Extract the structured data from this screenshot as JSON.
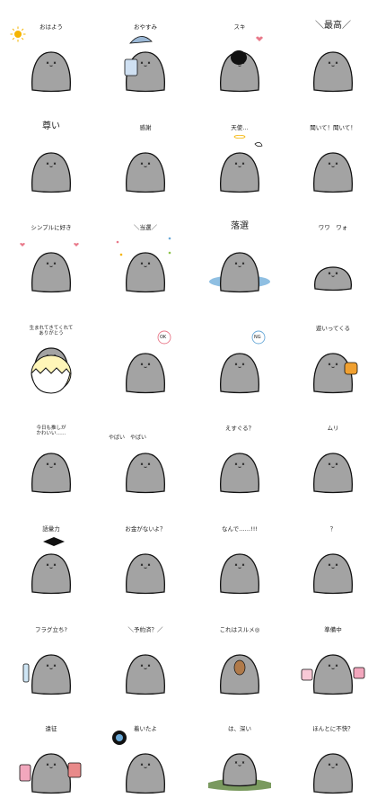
{
  "sheet_title": "",
  "stickers": [
    {
      "caption": "おはよう",
      "icon": "sun-icon"
    },
    {
      "caption": "おやすみ",
      "icon": "nightcap-icon"
    },
    {
      "caption": "スキ",
      "icon": "heart-icon"
    },
    {
      "caption": "＼最高／",
      "icon": ""
    },
    {
      "caption": "尊い",
      "icon": ""
    },
    {
      "caption": "感謝",
      "icon": ""
    },
    {
      "caption": "天使…",
      "icon": "wings-icon"
    },
    {
      "caption": "聞いて！聞いて！",
      "icon": ""
    },
    {
      "caption": "シンプルに好き",
      "icon": "hearts-icon"
    },
    {
      "caption": "＼当選／",
      "icon": "sparkle-icon"
    },
    {
      "caption": "落選",
      "icon": "puddle-icon"
    },
    {
      "caption": "ワワ　ワォ",
      "icon": ""
    },
    {
      "caption": "生まれてきてくれて\nありがとう",
      "icon": "egg-icon"
    },
    {
      "caption": "",
      "icon": "ok-bubble-icon",
      "bubble": "OK"
    },
    {
      "caption": "",
      "icon": "ng-bubble-icon",
      "bubble": "NG"
    },
    {
      "caption": "遊いってくる",
      "icon": "bag-icon"
    },
    {
      "caption": "今日も推しが\nかわいい……",
      "icon": ""
    },
    {
      "caption": "",
      "icon": "yabai-text-icon",
      "side": "やばい　やばい"
    },
    {
      "caption": "えすぐる？",
      "icon": ""
    },
    {
      "caption": "ムリ",
      "icon": ""
    },
    {
      "caption": "語彙力",
      "icon": "graduation-cap-icon"
    },
    {
      "caption": "お金がないよ？",
      "icon": ""
    },
    {
      "caption": "なんで……!!!",
      "icon": ""
    },
    {
      "caption": "？",
      "icon": ""
    },
    {
      "caption": "フラグ立ち?",
      "icon": "glowstick-icon"
    },
    {
      "caption": "＼予約済？／",
      "icon": ""
    },
    {
      "caption": "これはスルメ◎",
      "icon": "squid-icon"
    },
    {
      "caption": "準備中",
      "icon": "shopping-bags-icon"
    },
    {
      "caption": "遠征",
      "icon": "luggage-icon"
    },
    {
      "caption": "着いたよ",
      "icon": "pin-icon"
    },
    {
      "caption": "は、深い",
      "icon": "grass-mound-icon"
    },
    {
      "caption": "ほんとに不快？",
      "icon": ""
    }
  ],
  "colors": {
    "body": "#a3a3a3",
    "outline": "#111111",
    "accent_sun": "#f5b400",
    "accent_blue": "#6aa9d8",
    "accent_pink": "#e9798a",
    "accent_orange": "#f0a030",
    "accent_green": "#6b8f4e",
    "egg": "#fff6b8"
  }
}
